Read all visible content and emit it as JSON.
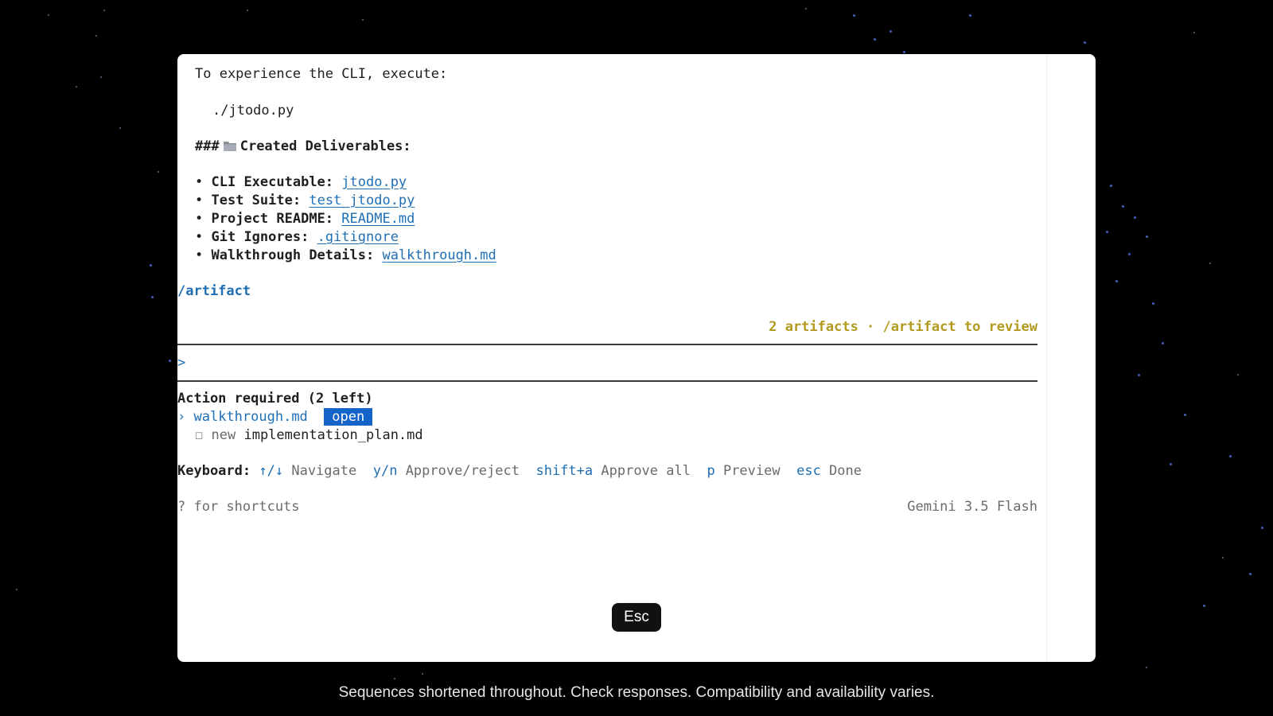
{
  "terminal": {
    "intro": "To experience the CLI, execute:",
    "command": "./jtodo.py",
    "section_prefix": "###",
    "section_icon": "folder-icon",
    "section_title": "Created Deliverables:",
    "deliverables": [
      {
        "label": "CLI Executable:",
        "file": "jtodo.py"
      },
      {
        "label": "Test Suite:",
        "file": "test_jtodo.py"
      },
      {
        "label": "Project README:",
        "file": "README.md"
      },
      {
        "label": "Git Ignores:",
        "file": ".gitignore"
      },
      {
        "label": "Walkthrough Details:",
        "file": "walkthrough.md"
      }
    ],
    "bullet": "•",
    "slash_command": "/artifact",
    "artifact_status": "2 artifacts · /artifact to review",
    "prompt_symbol": ">",
    "action_title": "Action required (2 left)",
    "items": [
      {
        "marker": "›",
        "name": "walkthrough.md",
        "badge": "open"
      },
      {
        "marker": "☐",
        "tag": "new",
        "name": "implementation_plan.md"
      }
    ],
    "keyboard": {
      "label": "Keyboard:",
      "hints": [
        {
          "key": "↑/↓",
          "action": "Navigate"
        },
        {
          "key": "y/n",
          "action": "Approve/reject"
        },
        {
          "key": "shift+a",
          "action": "Approve all"
        },
        {
          "key": "p",
          "action": "Preview"
        },
        {
          "key": "esc",
          "action": "Done"
        }
      ]
    },
    "shortcuts_hint": "? for shortcuts",
    "model_name": "Gemini 3.5 Flash"
  },
  "overlay_key": "Esc",
  "caption": "Sequences shortened throughout. Check responses. Compatibility and availability varies.",
  "colors": {
    "link": "#1f6fb5",
    "status": "#b29a1f",
    "badge": "#1463c8",
    "background": "#000000"
  }
}
